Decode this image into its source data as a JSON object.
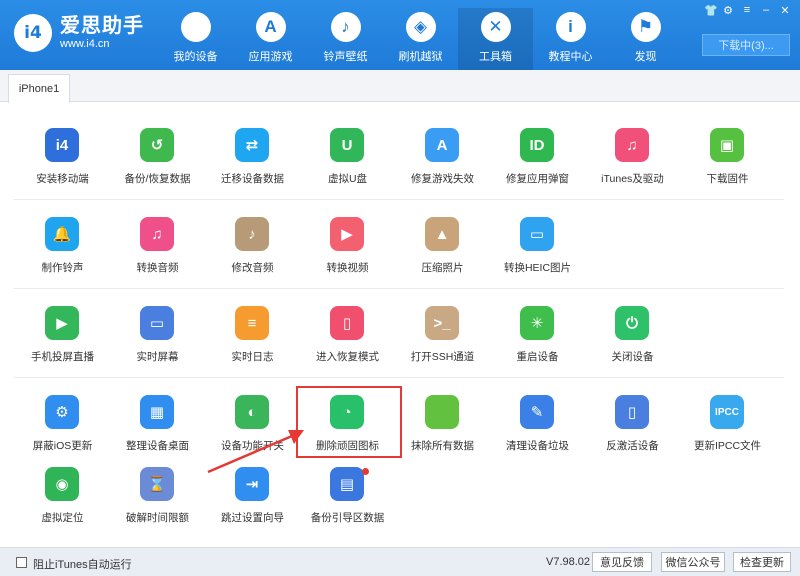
{
  "app": {
    "name": "爱思助手",
    "url": "www.i4.cn",
    "logo_text": "i4"
  },
  "nav": [
    {
      "label": "我的设备",
      "icon": "apple-icon",
      "glyph": ""
    },
    {
      "label": "应用游戏",
      "icon": "app-store-icon",
      "glyph": "A"
    },
    {
      "label": "铃声壁纸",
      "icon": "music-wallpaper-icon",
      "glyph": "♪"
    },
    {
      "label": "刷机越狱",
      "icon": "flash-box-icon",
      "glyph": "◈"
    },
    {
      "label": "工具箱",
      "icon": "toolbox-icon",
      "glyph": "✕"
    },
    {
      "label": "教程中心",
      "icon": "info-icon",
      "glyph": "i"
    },
    {
      "label": "发现",
      "icon": "flag-icon",
      "glyph": "⚑"
    }
  ],
  "window": {
    "download_label": "下载中(3)..."
  },
  "device_tab": "iPhone1",
  "tools": [
    {
      "label": "安装移动端",
      "color": "#2f6fdb",
      "glyph": "i4",
      "icon": "i4-install-icon"
    },
    {
      "label": "备份/恢复数据",
      "color": "#3fb94e",
      "glyph": "↺",
      "icon": "backup-restore-icon"
    },
    {
      "label": "迁移设备数据",
      "color": "#1fa6f0",
      "glyph": "⇄",
      "icon": "migrate-icon"
    },
    {
      "label": "虚拟U盘",
      "color": "#31b65a",
      "glyph": "U",
      "icon": "usb-drive-icon"
    },
    {
      "label": "修复游戏失效",
      "color": "#3a9cf2",
      "glyph": "A",
      "icon": "app-repair-icon"
    },
    {
      "label": "修复应用弹窗",
      "color": "#2eb84f",
      "glyph": "ID",
      "icon": "apple-id-icon"
    },
    {
      "label": "iTunes及驱动",
      "color": "#f0507a",
      "glyph": "♫",
      "icon": "itunes-icon"
    },
    {
      "label": "下载固件",
      "color": "#56c040",
      "glyph": "▣",
      "icon": "firmware-box-icon"
    },
    {
      "label": "制作铃声",
      "color": "#1fa4f0",
      "glyph": "🔔",
      "icon": "bell-icon"
    },
    {
      "label": "转换音频",
      "color": "#f0508a",
      "glyph": "♫",
      "icon": "convert-audio-icon"
    },
    {
      "label": "修改音频",
      "color": "#b79a78",
      "glyph": "♪",
      "icon": "edit-audio-icon"
    },
    {
      "label": "转换视频",
      "color": "#f36070",
      "glyph": "▶",
      "icon": "convert-video-icon"
    },
    {
      "label": "压缩照片",
      "color": "#c9a37a",
      "glyph": "▲",
      "icon": "compress-photo-icon"
    },
    {
      "label": "转换HEIC图片",
      "color": "#2fa3ef",
      "glyph": "▭",
      "icon": "heic-convert-icon"
    },
    {
      "label": "手机投屏直播",
      "color": "#34b75a",
      "glyph": "▶",
      "icon": "screen-cast-icon"
    },
    {
      "label": "实时屏幕",
      "color": "#4a7fe0",
      "glyph": "▭",
      "icon": "live-screen-icon"
    },
    {
      "label": "实时日志",
      "color": "#f59b2f",
      "glyph": "≡",
      "icon": "live-log-icon"
    },
    {
      "label": "进入恢复模式",
      "color": "#f0506e",
      "glyph": "▯",
      "icon": "recovery-mode-icon"
    },
    {
      "label": "打开SSH通道",
      "color": "#c9a884",
      "glyph": ">_",
      "icon": "ssh-terminal-icon"
    },
    {
      "label": "重启设备",
      "color": "#3fbe4c",
      "glyph": "✳",
      "icon": "reboot-icon"
    },
    {
      "label": "关闭设备",
      "color": "#2fc06a",
      "glyph": "⏻",
      "icon": "power-off-icon"
    },
    {
      "label": "屏蔽iOS更新",
      "color": "#2f8ef0",
      "glyph": "⚙",
      "icon": "block-update-icon"
    },
    {
      "label": "整理设备桌面",
      "color": "#2f8ef0",
      "glyph": "▦",
      "icon": "desktop-grid-icon"
    },
    {
      "label": "设备功能开关",
      "color": "#3bb55a",
      "glyph": "◐",
      "icon": "feature-toggle-icon"
    },
    {
      "label": "删除顽固图标",
      "color": "#29c06a",
      "glyph": "◔",
      "icon": "delete-icon-pie-icon"
    },
    {
      "label": "抹除所有数据",
      "color": "#62c23f",
      "glyph": "",
      "icon": "erase-data-icon"
    },
    {
      "label": "清理设备垃圾",
      "color": "#3a80e6",
      "glyph": "✎",
      "icon": "clean-junk-icon"
    },
    {
      "label": "反激活设备",
      "color": "#4a7fe0",
      "glyph": "▯",
      "icon": "deactivate-icon"
    },
    {
      "label": "更新IPCC文件",
      "color": "#38a8ef",
      "glyph": "IPCC",
      "icon": "ipcc-icon"
    },
    {
      "label": "虚拟定位",
      "color": "#2fb457",
      "glyph": "◉",
      "icon": "location-pin-icon"
    },
    {
      "label": "破解时间限额",
      "color": "#6b8bd6",
      "glyph": "⌛",
      "icon": "hourglass-icon"
    },
    {
      "label": "跳过设置向导",
      "color": "#2f8ef0",
      "glyph": "⇥",
      "icon": "skip-setup-icon"
    },
    {
      "label": "备份引导区数据",
      "color": "#3a78e0",
      "glyph": "▤",
      "icon": "backup-boot-icon"
    }
  ],
  "footer": {
    "checkbox_label": "阻止iTunes自动运行",
    "version": "V7.98.02",
    "feedback": "意见反馈",
    "wechat": "微信公众号",
    "update": "检查更新"
  }
}
